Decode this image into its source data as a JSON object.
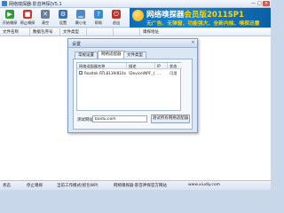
{
  "window": {
    "title": "网络嗅探器·影音神探|V5.1",
    "min_label": "—",
    "max_label": "□",
    "close_label": "×"
  },
  "toolbar": {
    "buttons": [
      {
        "label": "开始嗅探",
        "icon": "play-icon",
        "glyph": "▶",
        "color": "#2e9b36"
      },
      {
        "label": "停止嗅探",
        "icon": "stop-icon",
        "glyph": "■",
        "color": "#c23b2e"
      },
      {
        "label": "清空",
        "icon": "clear-icon",
        "glyph": "✕",
        "color": "#6a7f9b"
      },
      {
        "label": "设置",
        "icon": "gear-icon",
        "glyph": "⚙",
        "color": "#3a6fb0"
      },
      {
        "label": "最小化",
        "icon": "minimize-icon",
        "glyph": "▁",
        "color": "#4d89c9"
      },
      {
        "label": "帮助",
        "icon": "help-icon",
        "glyph": "?",
        "color": "#3a8ad6"
      },
      {
        "label": "退出",
        "icon": "exit-icon",
        "glyph": "⏻",
        "color": "#b8342a"
      }
    ]
  },
  "banner": {
    "title_main": "网络嗅探器",
    "title_highlight": "会员版2011SP1",
    "subtitle": "无广告、无弹窗、功能强大、全新内核、嗅探迅雷"
  },
  "columns": [
    "文件名称",
    "数据包序号",
    "文件类型",
    "",
    "",
    "嗅探地址"
  ],
  "dialog": {
    "title": "设置",
    "close_label": "×",
    "tabs": [
      "常规设置",
      "网络适配器",
      "文件类型"
    ],
    "active_tab": 1,
    "table": {
      "headers": [
        "网络适配器名称",
        "描述",
        "IP",
        "状态"
      ],
      "rows": [
        {
          "checked": true,
          "name": "Realtek RTL8139/810x Family...",
          "desc": "\\Device\\NPF_{A...",
          "ip": "...",
          "status": "可用"
        }
      ]
    },
    "test_label": "测试网址：",
    "test_url": "baidu.com",
    "test_button": "测试所有网络适配器"
  },
  "status": {
    "state": "状态",
    "stopped": "停止嗅探",
    "mode": "当前工作模式(抓包WP)",
    "product": "网络嗅探器·影音神探官方网站",
    "url": "www.xiudiy.com"
  }
}
